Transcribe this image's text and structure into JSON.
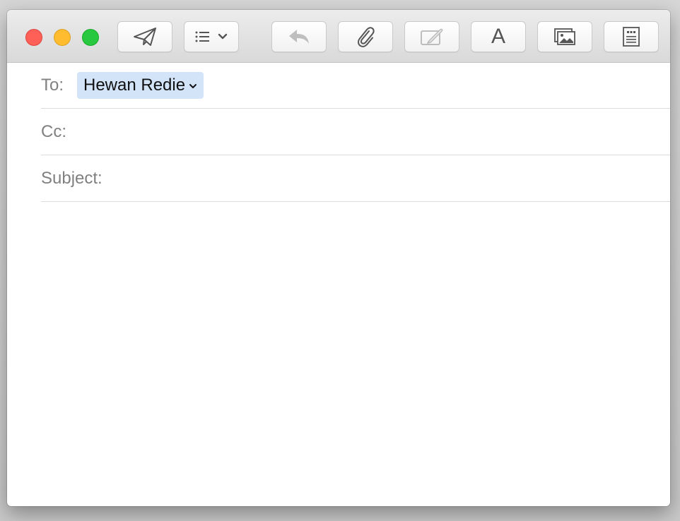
{
  "window": {
    "traffic_lights": {
      "close": "#fe5f57",
      "minimize": "#febc2e",
      "zoom": "#28c840"
    }
  },
  "toolbar": {
    "buttons": [
      {
        "icon": "send-icon",
        "enabled": true
      },
      {
        "icon": "header-fields-icon",
        "enabled": true
      },
      {
        "icon": "reply-icon",
        "enabled": false
      },
      {
        "icon": "paperclip-icon",
        "enabled": true
      },
      {
        "icon": "markup-icon",
        "enabled": false
      },
      {
        "icon": "font-icon",
        "enabled": true,
        "glyph": "A"
      },
      {
        "icon": "photo-browser-icon",
        "enabled": true
      },
      {
        "icon": "stationery-icon",
        "enabled": true
      }
    ]
  },
  "compose": {
    "to_label": "To:",
    "to_recipient": "Hewan Redie",
    "cc_label": "Cc:",
    "cc_value": "",
    "subject_label": "Subject:",
    "subject_value": "",
    "body": ""
  },
  "colors": {
    "token_background": "#d3e3f8",
    "label_gray": "#808080"
  }
}
